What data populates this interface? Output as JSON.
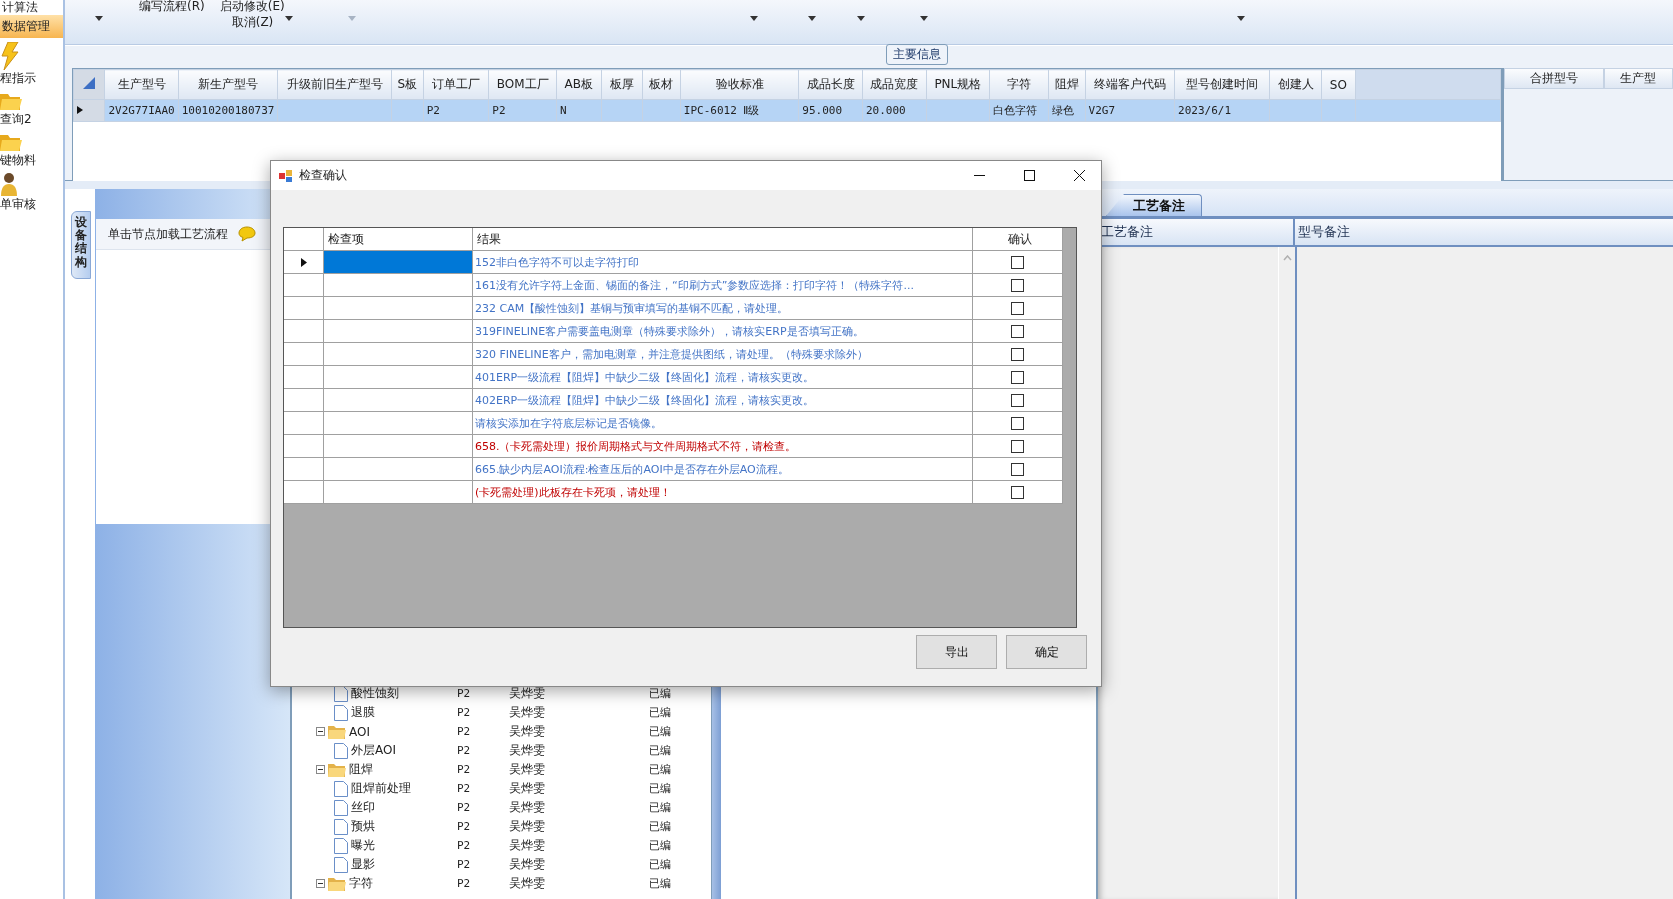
{
  "sidebar": {
    "items": [
      {
        "label": "计算法",
        "kind": "text",
        "selected": false
      },
      {
        "label": "数据管理",
        "kind": "text",
        "selected": true
      },
      {
        "label": "程指示",
        "kind": "process",
        "selected": false
      },
      {
        "label": "查询2",
        "kind": "query",
        "selected": false
      },
      {
        "label": "键物料",
        "kind": "material",
        "selected": false
      },
      {
        "label": "单审核",
        "kind": "review",
        "selected": false
      }
    ]
  },
  "toolbar": {
    "labels": [
      "编写流程(R)",
      "启动修改(E)",
      "取消(Z)"
    ],
    "dropdowns": [
      {
        "disabled": false
      },
      {
        "disabled": false
      },
      {
        "disabled": true
      },
      {
        "disabled": false
      },
      {
        "disabled": false
      },
      {
        "disabled": false
      },
      {
        "disabled": false
      },
      {
        "disabled": false
      }
    ]
  },
  "main_info": {
    "title": "主要信息",
    "table": {
      "columns": [
        "生产型号",
        "新生产型号",
        "升级前旧生产型号",
        "S板",
        "订单工厂",
        "BOM工厂",
        "AB板",
        "板厚",
        "板材",
        "验收标准",
        "成品长度",
        "成品宽度",
        "PNL规格",
        "字符",
        "阻焊",
        "终端客户代码",
        "型号创建时间",
        "创建人",
        "SO"
      ],
      "rows": [
        {
          "selected": true,
          "cells": [
            "2V2G77IAA0",
            "10010200180737",
            null,
            null,
            "P2",
            "P2",
            "N",
            null,
            null,
            "IPC-6012 Ⅱ级",
            "95.000",
            "20.000",
            null,
            "白色字符",
            "绿色",
            "V2G7",
            "2023/6/1",
            null,
            null
          ]
        }
      ]
    },
    "side_table": {
      "columns": [
        "合拼型号",
        "生产型"
      ]
    }
  },
  "process_panel": {
    "tab": "设备结构",
    "hint": "单击节点加载工艺流程"
  },
  "tree": {
    "nodes": [
      {
        "children": [
          {
            "label": "酸性蚀刻",
            "factory": "P2",
            "person": "吴烨雯",
            "status": "已编"
          },
          {
            "label": "退膜",
            "factory": "P2",
            "person": "吴烨雯",
            "status": "已编"
          }
        ]
      },
      {
        "label": "AOI",
        "factory": "P2",
        "person": "吴烨雯",
        "status": "已编",
        "expanded": true,
        "children": [
          {
            "label": "外层AOI",
            "factory": "P2",
            "person": "吴烨雯",
            "status": "已编"
          }
        ]
      },
      {
        "label": "阻焊",
        "factory": "P2",
        "person": "吴烨雯",
        "status": "已编",
        "expanded": true,
        "children": [
          {
            "label": "阻焊前处理",
            "factory": "P2",
            "person": "吴烨雯",
            "status": "已编"
          },
          {
            "label": "丝印",
            "factory": "P2",
            "person": "吴烨雯",
            "status": "已编"
          },
          {
            "label": "预烘",
            "factory": "P2",
            "person": "吴烨雯",
            "status": "已编"
          },
          {
            "label": "曝光",
            "factory": "P2",
            "person": "吴烨雯",
            "status": "已编"
          },
          {
            "label": "显影",
            "factory": "P2",
            "person": "吴烨雯",
            "status": "已编"
          }
        ]
      },
      {
        "label": "字符",
        "factory": "P2",
        "person": "吴烨雯",
        "status": "已编",
        "expanded": true
      }
    ]
  },
  "notes_panel": {
    "tabs": [
      {
        "label": "工艺备注",
        "selected": true
      }
    ],
    "columns": [
      "工艺备注",
      "型号备注"
    ]
  },
  "dialog": {
    "title": "检查确认",
    "columns": [
      "检查项",
      "结果",
      "确认"
    ],
    "rows": [
      {
        "selected": true,
        "kind": "warning",
        "result": "152非白色字符不可以走字符打印",
        "checked": false
      },
      {
        "selected": false,
        "kind": "warning",
        "result": "161没有允许字符上金面、锡面的备注，“印刷方式”参数应选择：打印字符！（特殊字符...",
        "checked": false
      },
      {
        "selected": false,
        "kind": "warning",
        "result": "232 CAM【酸性蚀刻】基铜与预审填写的基铜不匹配，请处理。",
        "checked": false
      },
      {
        "selected": false,
        "kind": "warning",
        "result": "319FINELINE客户需要盖电测章（特殊要求除外），请核实ERP是否填写正确。",
        "checked": false
      },
      {
        "selected": false,
        "kind": "warning",
        "result": "320 FINELINE客户，需加电测章，并注意提供图纸，请处理。（特殊要求除外）",
        "checked": false
      },
      {
        "selected": false,
        "kind": "warning",
        "result": "401ERP一级流程【阻焊】中缺少二级【终固化】流程，请核实更改。",
        "checked": false
      },
      {
        "selected": false,
        "kind": "warning",
        "result": "402ERP一级流程【阻焊】中缺少二级【终固化】流程，请核实更改。",
        "checked": false
      },
      {
        "selected": false,
        "kind": "warning",
        "result": "请核实添加在字符底层标记是否镜像。",
        "checked": false
      },
      {
        "selected": false,
        "kind": "blocking",
        "result": "658.（卡死需处理）报价周期格式与文件周期格式不符，请检查。",
        "checked": false
      },
      {
        "selected": false,
        "kind": "warning",
        "result": "665.缺少内层AOI流程:检查压后的AOI中是否存在外层AO流程。",
        "checked": false
      },
      {
        "selected": false,
        "kind": "blocking",
        "result": "(卡死需处理)此板存在卡死项，请处理！",
        "checked": false
      }
    ],
    "buttons": [
      "导出",
      "确定"
    ]
  }
}
